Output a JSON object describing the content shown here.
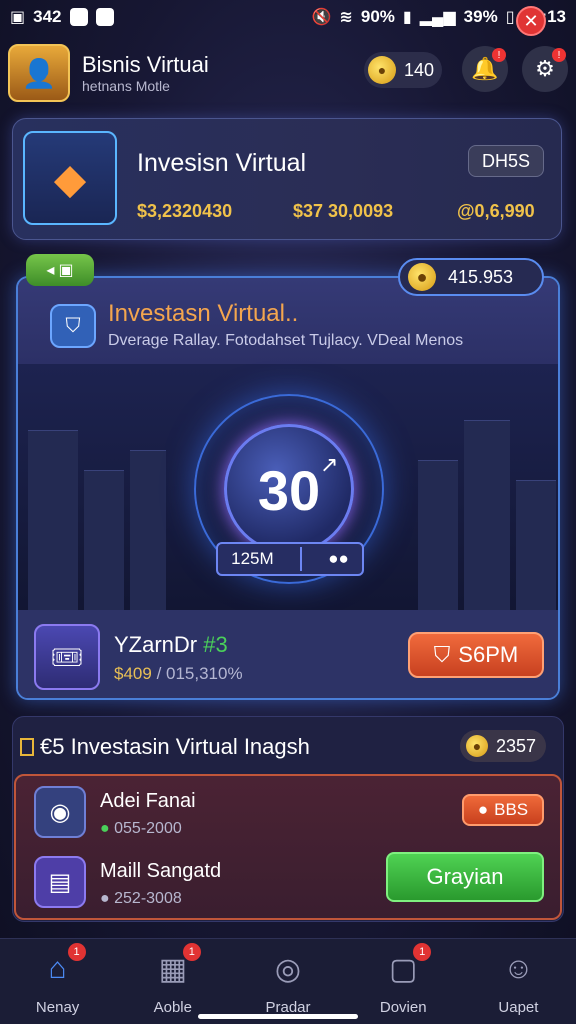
{
  "status_bar": {
    "left_text": "342",
    "battery_pct_1": "90%",
    "battery_pct_2": "39%",
    "time": "22:13"
  },
  "header": {
    "title": "Bisnis Virtuai",
    "subtitle": "hetnans Motle",
    "coin_value": "140"
  },
  "top_card": {
    "title": "Invesisn Virtual",
    "pill": "DH5S",
    "stat_1": "$3,2320430",
    "stat_2": "$37 30,0093",
    "stat_3": "@0,6,990"
  },
  "main_panel": {
    "score": "415.953",
    "title": "Investasn Virtual..",
    "subtitle": "Dverage Rallay. Fotodahset Tujlacy. VDeal Menos",
    "big_number": "30",
    "mini_pill_value": "125M",
    "item_title_prefix": "YZarnDr",
    "item_title_suffix": "#3",
    "item_meta_value": "$409",
    "item_meta_rest": "/ 015,310%",
    "action_label": "S6PM"
  },
  "list": {
    "title": "€5 Investasin Virtual Inagsh",
    "badge": "2357",
    "rows": [
      {
        "name": "Adei Fanai",
        "range": "055-2000",
        "button": "BBS"
      },
      {
        "name": "Maill Sangatd",
        "range": "252-3008",
        "button": "Grayian"
      }
    ]
  },
  "nav": {
    "items": [
      {
        "label": "Nenay",
        "icon": "home-icon",
        "badge": "1"
      },
      {
        "label": "Aoble",
        "icon": "calendar-icon",
        "badge": "1"
      },
      {
        "label": "Pradar",
        "icon": "compass-icon",
        "badge": ""
      },
      {
        "label": "Dovien",
        "icon": "document-icon",
        "badge": "1"
      },
      {
        "label": "Uapet",
        "icon": "user-icon",
        "badge": ""
      }
    ]
  },
  "colors": {
    "accent_blue": "#4a7fd8",
    "gold": "#f0c24a",
    "orange": "#f4a64e",
    "green": "#4fd253",
    "red": "#e03434"
  }
}
